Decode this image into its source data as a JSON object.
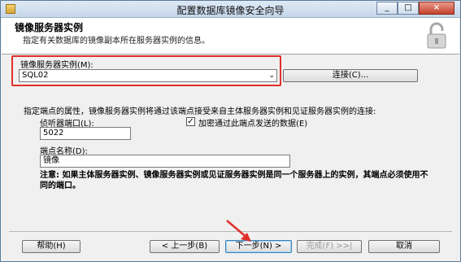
{
  "window": {
    "title": "配置数据库镜像安全向导",
    "min": "_",
    "max": "□",
    "close": "×"
  },
  "header": {
    "title": "镜像服务器实例",
    "subtitle": "指定有关数据库的镜像副本所在服务器实例的信息。"
  },
  "mirror": {
    "label": "镜像服务器实例(M):",
    "value": "SQL02",
    "connect": "连接(C)..."
  },
  "endpoint": {
    "intro": "指定端点的属性，镜像服务器实例将通过该端点接受来自主体服务器实例和见证服务器实例的连接:",
    "port_label": "侦听器端口(L):",
    "port_value": "5022",
    "encrypt_label": "加密通过此端点发送的数据(E)",
    "encrypt_mark": "✓",
    "name_label": "端点名称(D):",
    "name_value": "镜像"
  },
  "note": "注意: 如果主体服务器实例、镜像服务器实例或见证服务器实例是同一个服务器上的实例，其端点必须使用不同的端口。",
  "buttons": {
    "help": "帮助(H)",
    "back": "< 上一步(B)",
    "next": "下一步(N) >",
    "finish": "完成(F) >>|",
    "cancel": "取消"
  },
  "colors": {
    "highlight": "#e0302a",
    "arrow": "#e0302a"
  }
}
